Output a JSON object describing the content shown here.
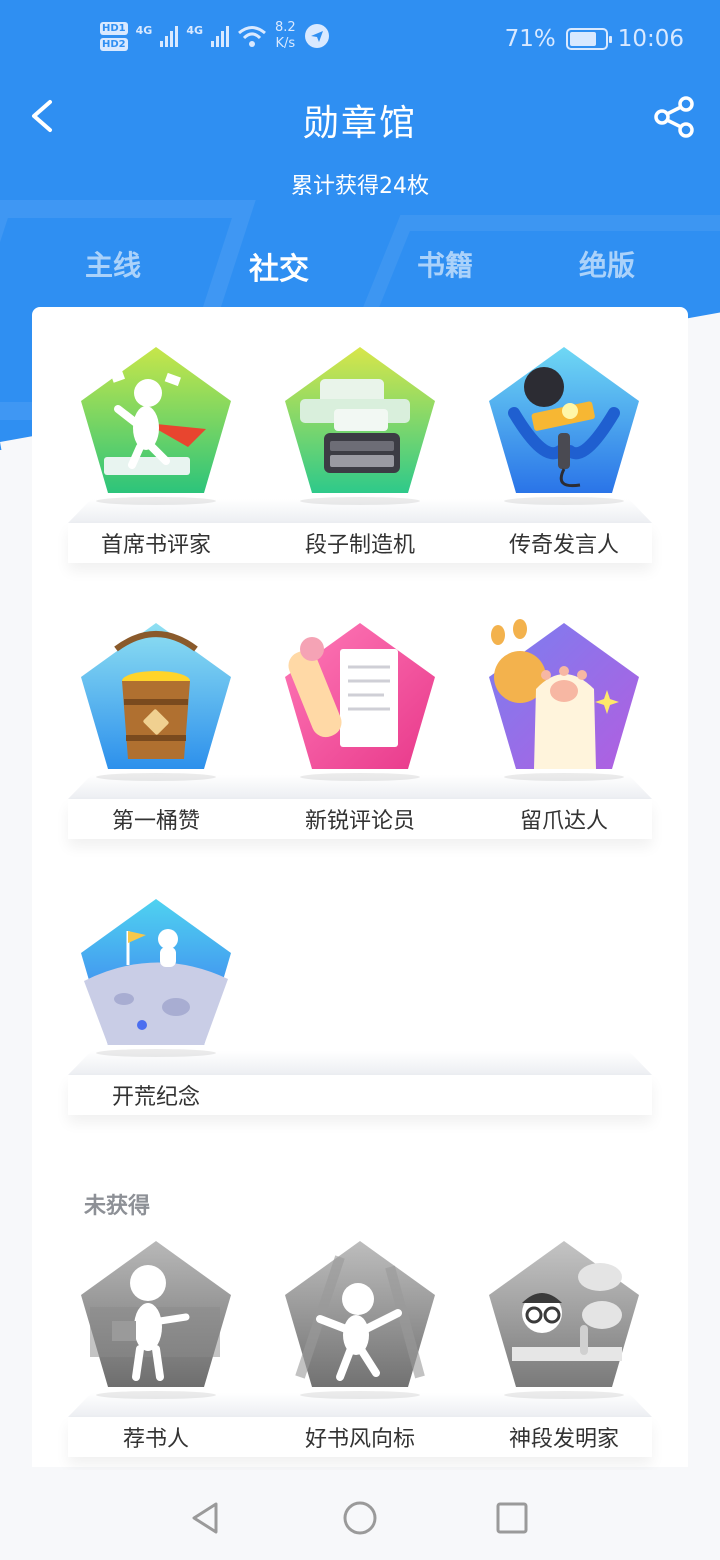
{
  "status_bar": {
    "hd1": "HD1",
    "hd2": "HD2",
    "net_type1": "4G",
    "net_type2": "4G",
    "speed_value": "8.2",
    "speed_unit": "K/s",
    "battery_percent": "71%",
    "time": "10:06"
  },
  "header": {
    "title": "勋章馆",
    "subtitle": "累计获得24枚"
  },
  "tabs": [
    {
      "label": "主线",
      "active": false
    },
    {
      "label": "社交",
      "active": true
    },
    {
      "label": "书籍",
      "active": false
    },
    {
      "label": "绝版",
      "active": false
    }
  ],
  "earned": [
    {
      "name": "首席书评家",
      "icon": "critic-badge-icon"
    },
    {
      "name": "段子制造机",
      "icon": "typewriter-badge-icon"
    },
    {
      "name": "传奇发言人",
      "icon": "microphone-badge-icon"
    },
    {
      "name": "第一桶赞",
      "icon": "bucket-badge-icon"
    },
    {
      "name": "新锐评论员",
      "icon": "pencil-badge-icon"
    },
    {
      "name": "留爪达人",
      "icon": "paw-badge-icon"
    },
    {
      "name": "开荒纪念",
      "icon": "moon-astronaut-badge-icon"
    }
  ],
  "unearned_section": {
    "title": "未获得",
    "items": [
      {
        "name": "荐书人",
        "icon": "recommender-badge-icon"
      },
      {
        "name": "好书风向标",
        "icon": "trendsetter-badge-icon"
      },
      {
        "name": "神段发明家",
        "icon": "inventor-badge-icon"
      }
    ]
  },
  "colors": {
    "header_blue": "#2f8ff2",
    "page_bg": "#f7f8fa"
  }
}
